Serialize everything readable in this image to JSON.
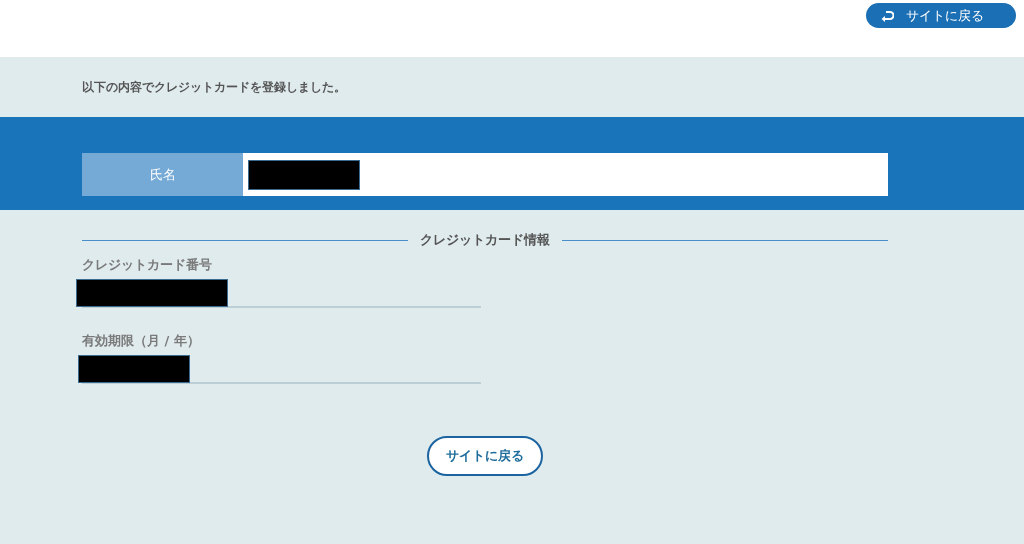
{
  "header": {
    "back_button": "サイトに戻る"
  },
  "message": "以下の内容でクレジットカードを登録しました。",
  "name_field": {
    "label": "氏名",
    "redacted": true
  },
  "card_section": {
    "title": "クレジットカード情報",
    "fields": [
      {
        "label": "クレジットカード番号",
        "redacted": true,
        "kind": "wide"
      },
      {
        "label": "有効期限（月 / 年）",
        "redacted": true,
        "kind": "short"
      }
    ]
  },
  "footer_button": "サイトに戻る"
}
